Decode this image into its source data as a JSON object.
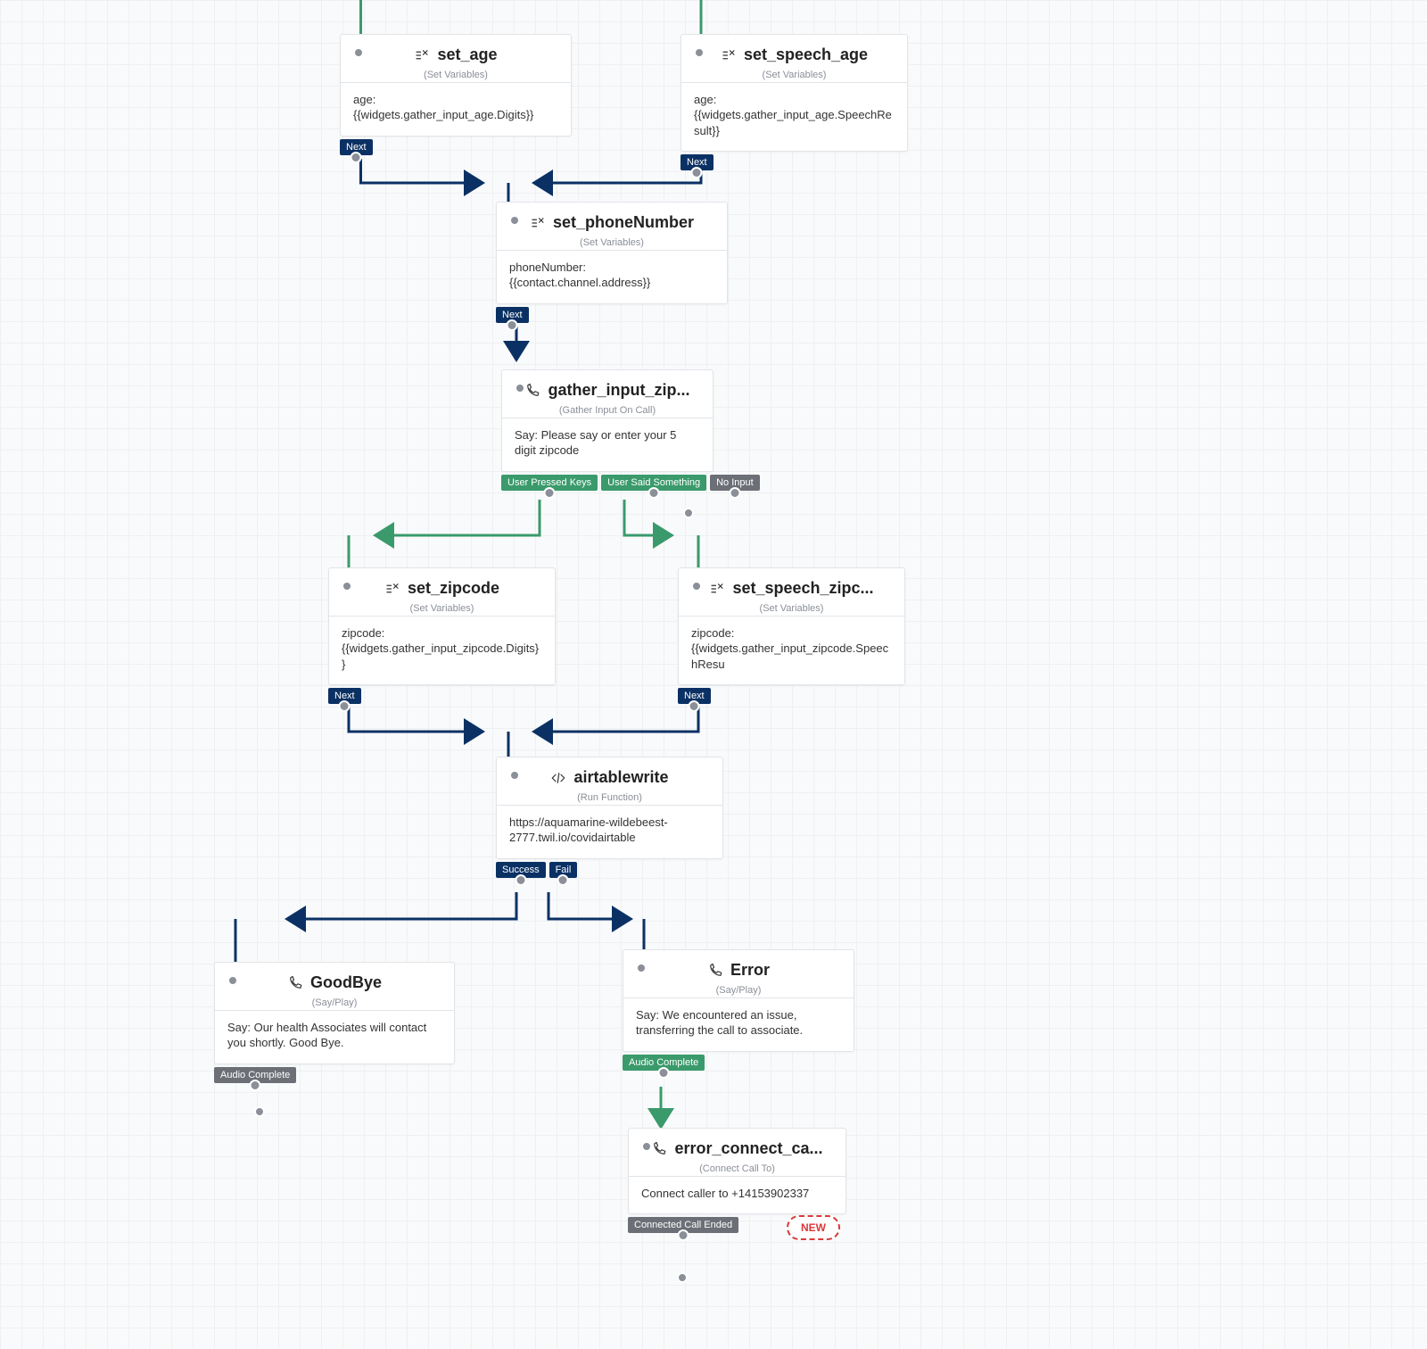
{
  "nodes": {
    "set_age": {
      "title": "set_age",
      "subtitle": "(Set Variables)",
      "body": "age: {{widgets.gather_input_age.Digits}}",
      "icon": "variables-icon",
      "tag_next": "Next"
    },
    "set_speech_age": {
      "title": "set_speech_age",
      "subtitle": "(Set Variables)",
      "body": "age:\n{{widgets.gather_input_age.SpeechResult}}",
      "icon": "variables-icon",
      "tag_next": "Next"
    },
    "set_phoneNumber": {
      "title": "set_phoneNumber",
      "subtitle": "(Set Variables)",
      "body": "phoneNumber: {{contact.channel.address}}",
      "icon": "variables-icon",
      "tag_next": "Next"
    },
    "gather_input_zip": {
      "title": "gather_input_zip...",
      "subtitle": "(Gather Input On Call)",
      "body": "Say: Please say or enter your 5 digit zipcode",
      "icon": "phone-icon",
      "tag_keys": "User Pressed Keys",
      "tag_said": "User Said Something",
      "tag_noin": "No Input"
    },
    "set_zipcode": {
      "title": "set_zipcode",
      "subtitle": "(Set Variables)",
      "body": "zipcode:\n{{widgets.gather_input_zipcode.Digits}}",
      "icon": "variables-icon",
      "tag_next": "Next"
    },
    "set_speech_zipcode": {
      "title": "set_speech_zipc...",
      "subtitle": "(Set Variables)",
      "body": "zipcode:\n{{widgets.gather_input_zipcode.SpeechResu",
      "icon": "variables-icon",
      "tag_next": "Next"
    },
    "airtablewrite": {
      "title": "airtablewrite",
      "subtitle": "(Run Function)",
      "body": "https://aquamarine-wildebeest-2777.twil.io/covidairtable",
      "icon": "code-icon",
      "tag_success": "Success",
      "tag_fail": "Fail"
    },
    "goodbye": {
      "title": "GoodBye",
      "subtitle": "(Say/Play)",
      "body": "Say: Our health Associates will contact you shortly. Good Bye.",
      "icon": "phone-icon",
      "tag_audio": "Audio Complete"
    },
    "error": {
      "title": "Error",
      "subtitle": "(Say/Play)",
      "body": "Say: We encountered an issue, transferring the call to associate.",
      "icon": "phone-icon",
      "tag_audio": "Audio Complete"
    },
    "error_connect": {
      "title": "error_connect_ca...",
      "subtitle": "(Connect Call To)",
      "body": "Connect caller to +14153902337",
      "icon": "phone-icon",
      "tag_ended": "Connected Call Ended",
      "pill_new": "NEW"
    }
  }
}
